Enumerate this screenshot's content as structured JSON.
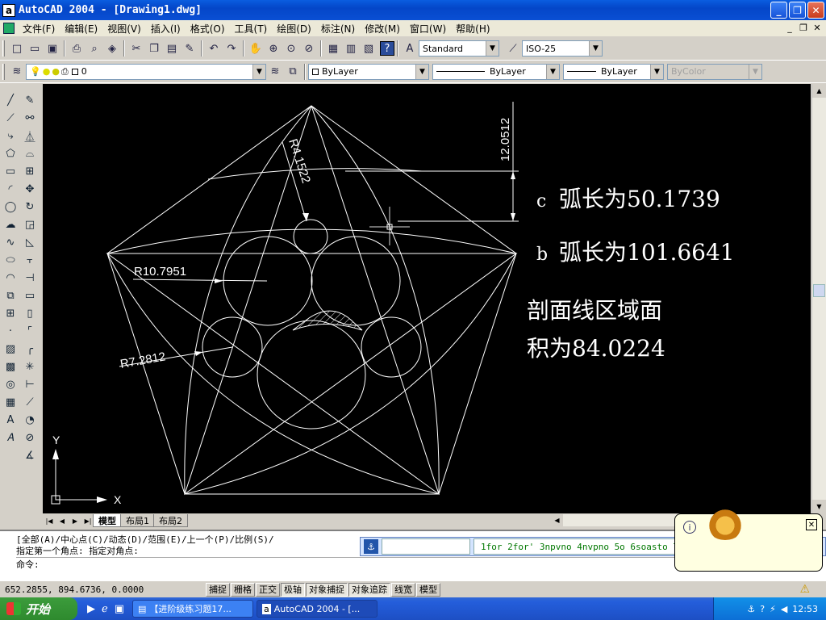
{
  "window": {
    "title": "AutoCAD 2004 - [Drawing1.dwg]",
    "app_icon": "a"
  },
  "menu": [
    "文件(F)",
    "编辑(E)",
    "视图(V)",
    "插入(I)",
    "格式(O)",
    "工具(T)",
    "绘图(D)",
    "标注(N)",
    "修改(M)",
    "窗口(W)",
    "帮助(H)"
  ],
  "toolbar": {
    "text_style": "Standard",
    "dim_style": "ISO-25"
  },
  "layers": {
    "current_layer": "0",
    "color": "ByLayer",
    "linetype": "ByLayer",
    "lineweight": "ByLayer",
    "plotstyle": "ByColor"
  },
  "drawing": {
    "dim_vertical": "12.0512",
    "dim_r1": "R4.1522",
    "dim_r2": "R10.7951",
    "dim_r3": "R7.2812",
    "note_c_letter": "c",
    "note_c": "弧长为50.1739",
    "note_b_letter": "b",
    "note_b": "弧长为101.6641",
    "note_area_1": "剖面线区域面",
    "note_area_2": "积为84.0224",
    "ucs_y": "Y",
    "ucs_x": "X"
  },
  "tabs": [
    "模型",
    "布局1",
    "布局2"
  ],
  "command": {
    "line1": "[全部(A)/中心点(C)/动态(D)/范围(E)/上一个(P)/比例(S)/",
    "line2": "指定第一个角点: 指定对角点:",
    "line3": "命令:"
  },
  "ime": {
    "composition": "1for 2for' 3npvno 4nvpno 5o 6soasto 7w",
    "page": "]"
  },
  "status": {
    "coords": "652.2855, 894.6736, 0.0000",
    "buttons": [
      "捕捉",
      "栅格",
      "正交",
      "极轴",
      "对象捕捉",
      "对象追踪",
      "线宽",
      "模型"
    ]
  },
  "taskbar": {
    "start": "开始",
    "tasks": [
      "【进阶级练习题17...",
      "AutoCAD 2004 - [..."
    ],
    "clock": "12:53"
  },
  "colors": {
    "canvas": "#000000",
    "title": "#0a4fd4",
    "status_on": "#e8e6de"
  }
}
